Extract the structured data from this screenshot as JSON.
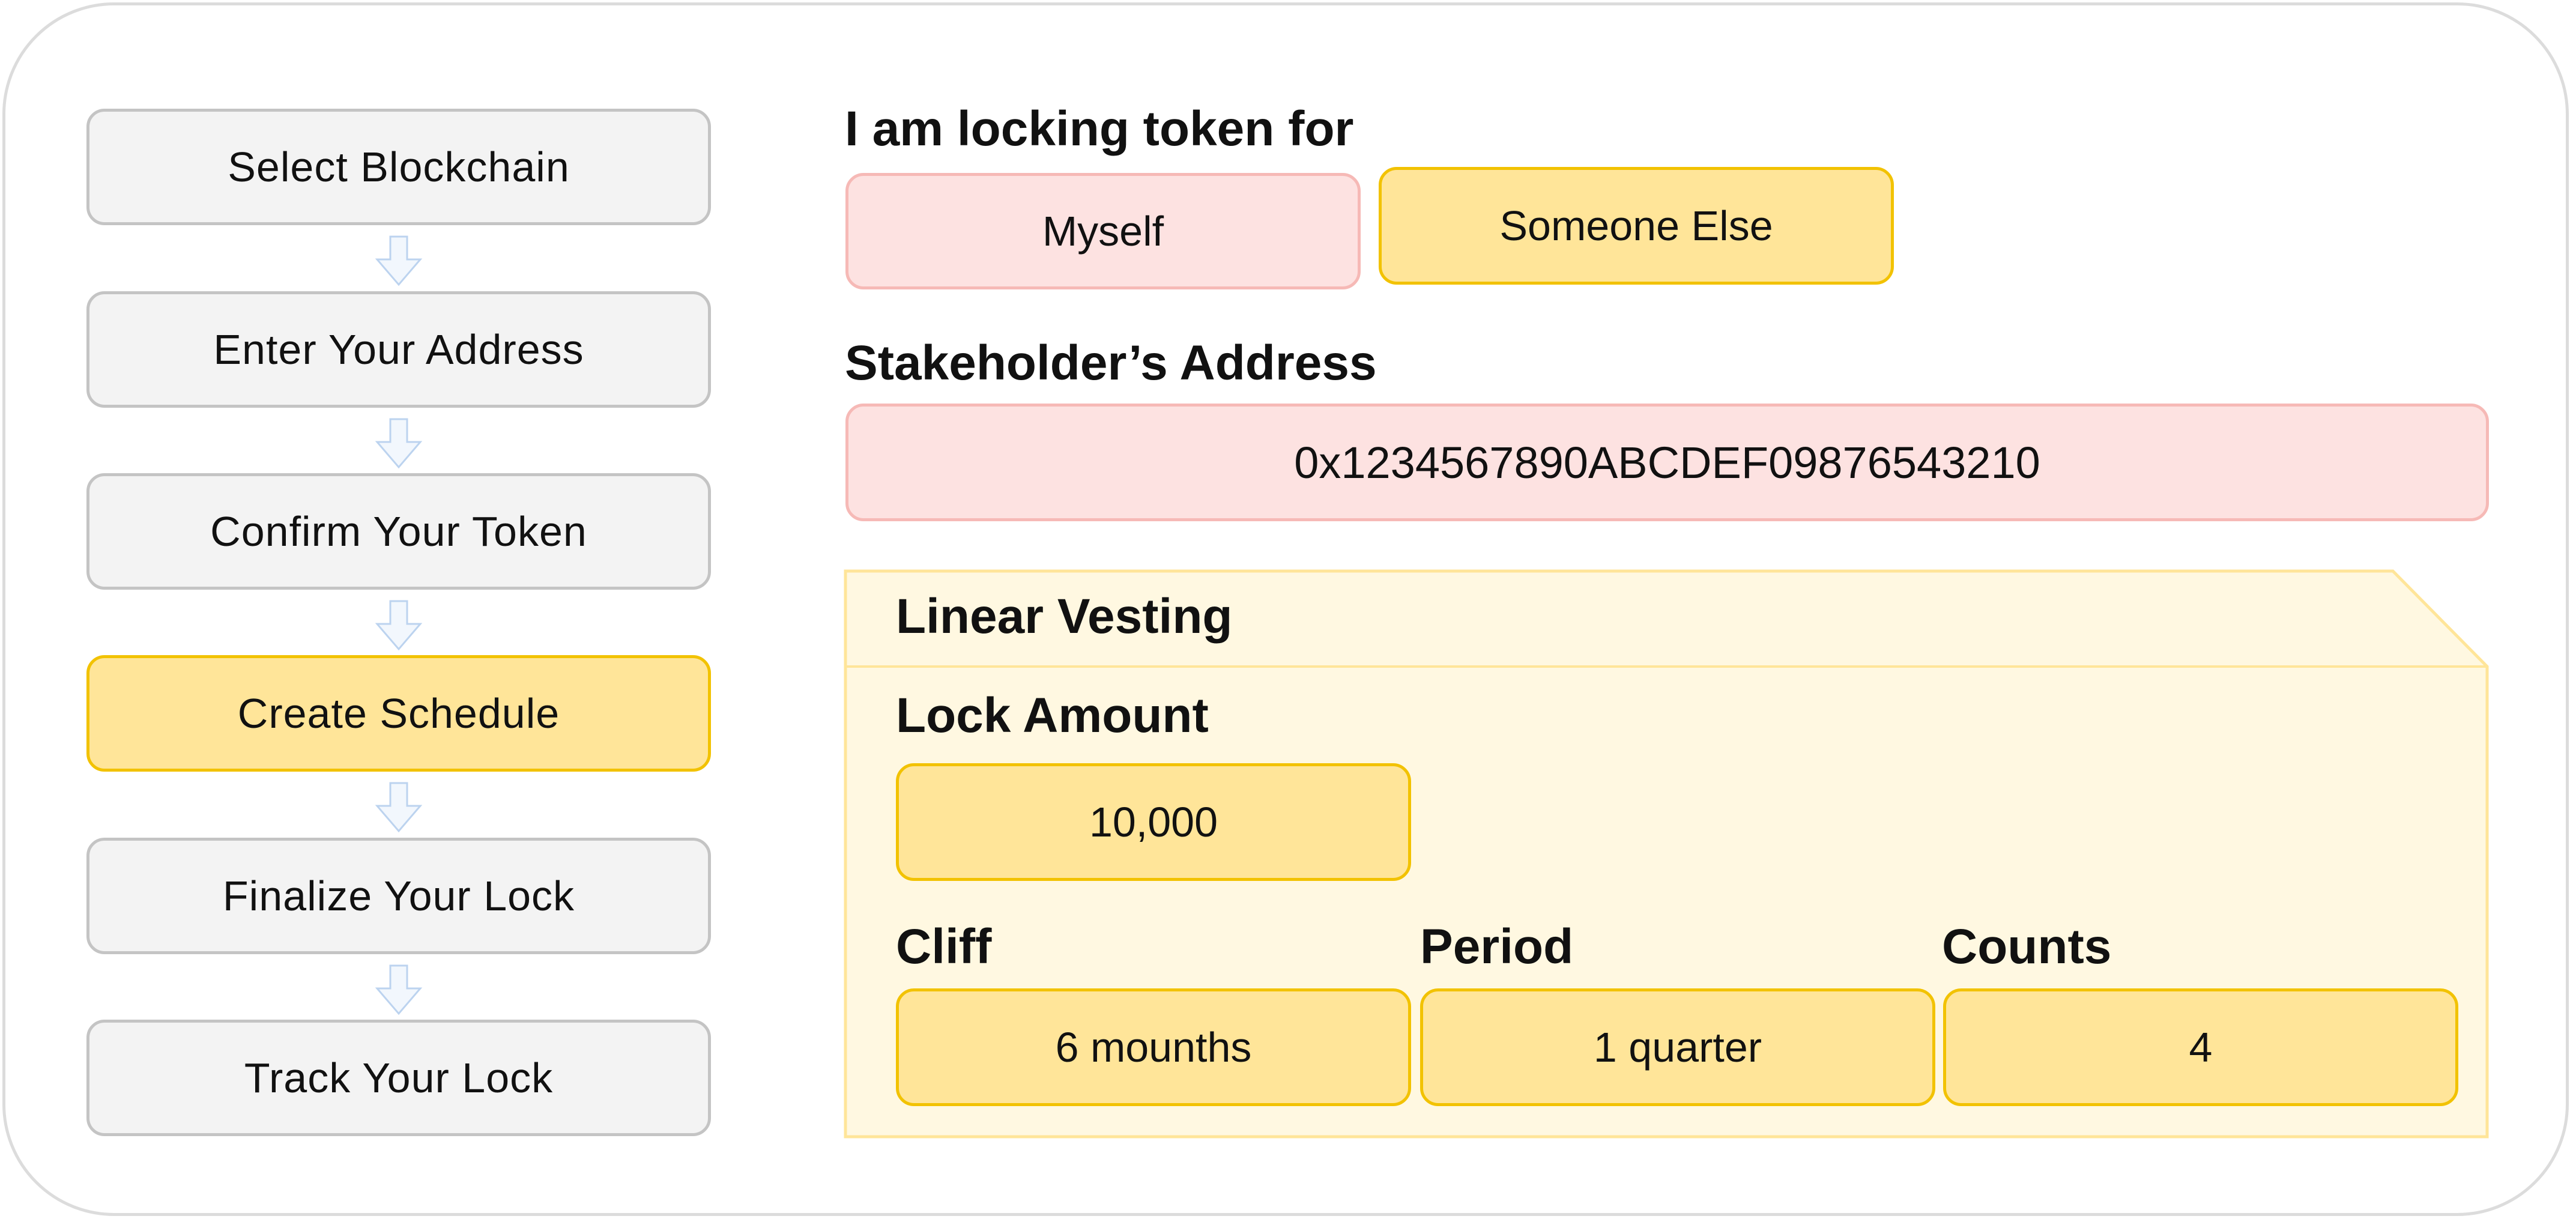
{
  "steps": [
    {
      "label": "Select Blockchain",
      "active": false
    },
    {
      "label": "Enter Your Address",
      "active": false
    },
    {
      "label": "Confirm Your Token",
      "active": false
    },
    {
      "label": "Create Schedule",
      "active": true
    },
    {
      "label": "Finalize Your Lock",
      "active": false
    },
    {
      "label": "Track Your Lock",
      "active": false
    }
  ],
  "locking": {
    "heading": "I am locking token for",
    "options": [
      "Myself",
      "Someone Else"
    ],
    "selected": "Someone Else"
  },
  "stakeholder": {
    "heading": "Stakeholder’s Address",
    "address": "0x1234567890ABCDEF09876543210"
  },
  "vesting": {
    "title": "Linear Vesting",
    "lock_amount_label": "Lock Amount",
    "lock_amount_value": "10,000",
    "cliff_label": "Cliff",
    "cliff_value": "6 mounths",
    "period_label": "Period",
    "period_value": "1 quarter",
    "counts_label": "Counts",
    "counts_value": "4"
  },
  "colors": {
    "active_fill": "#ffe599",
    "active_border": "#f2c200",
    "inactive_fill": "#f3f3f3",
    "inactive_border": "#c4c4c4",
    "pink_fill": "#fde2e1",
    "pink_border": "#f6b9b6",
    "panel_fill": "#fff8e1",
    "panel_border": "#ffe599"
  },
  "icons": {
    "step_connector": "down-arrow-icon"
  }
}
